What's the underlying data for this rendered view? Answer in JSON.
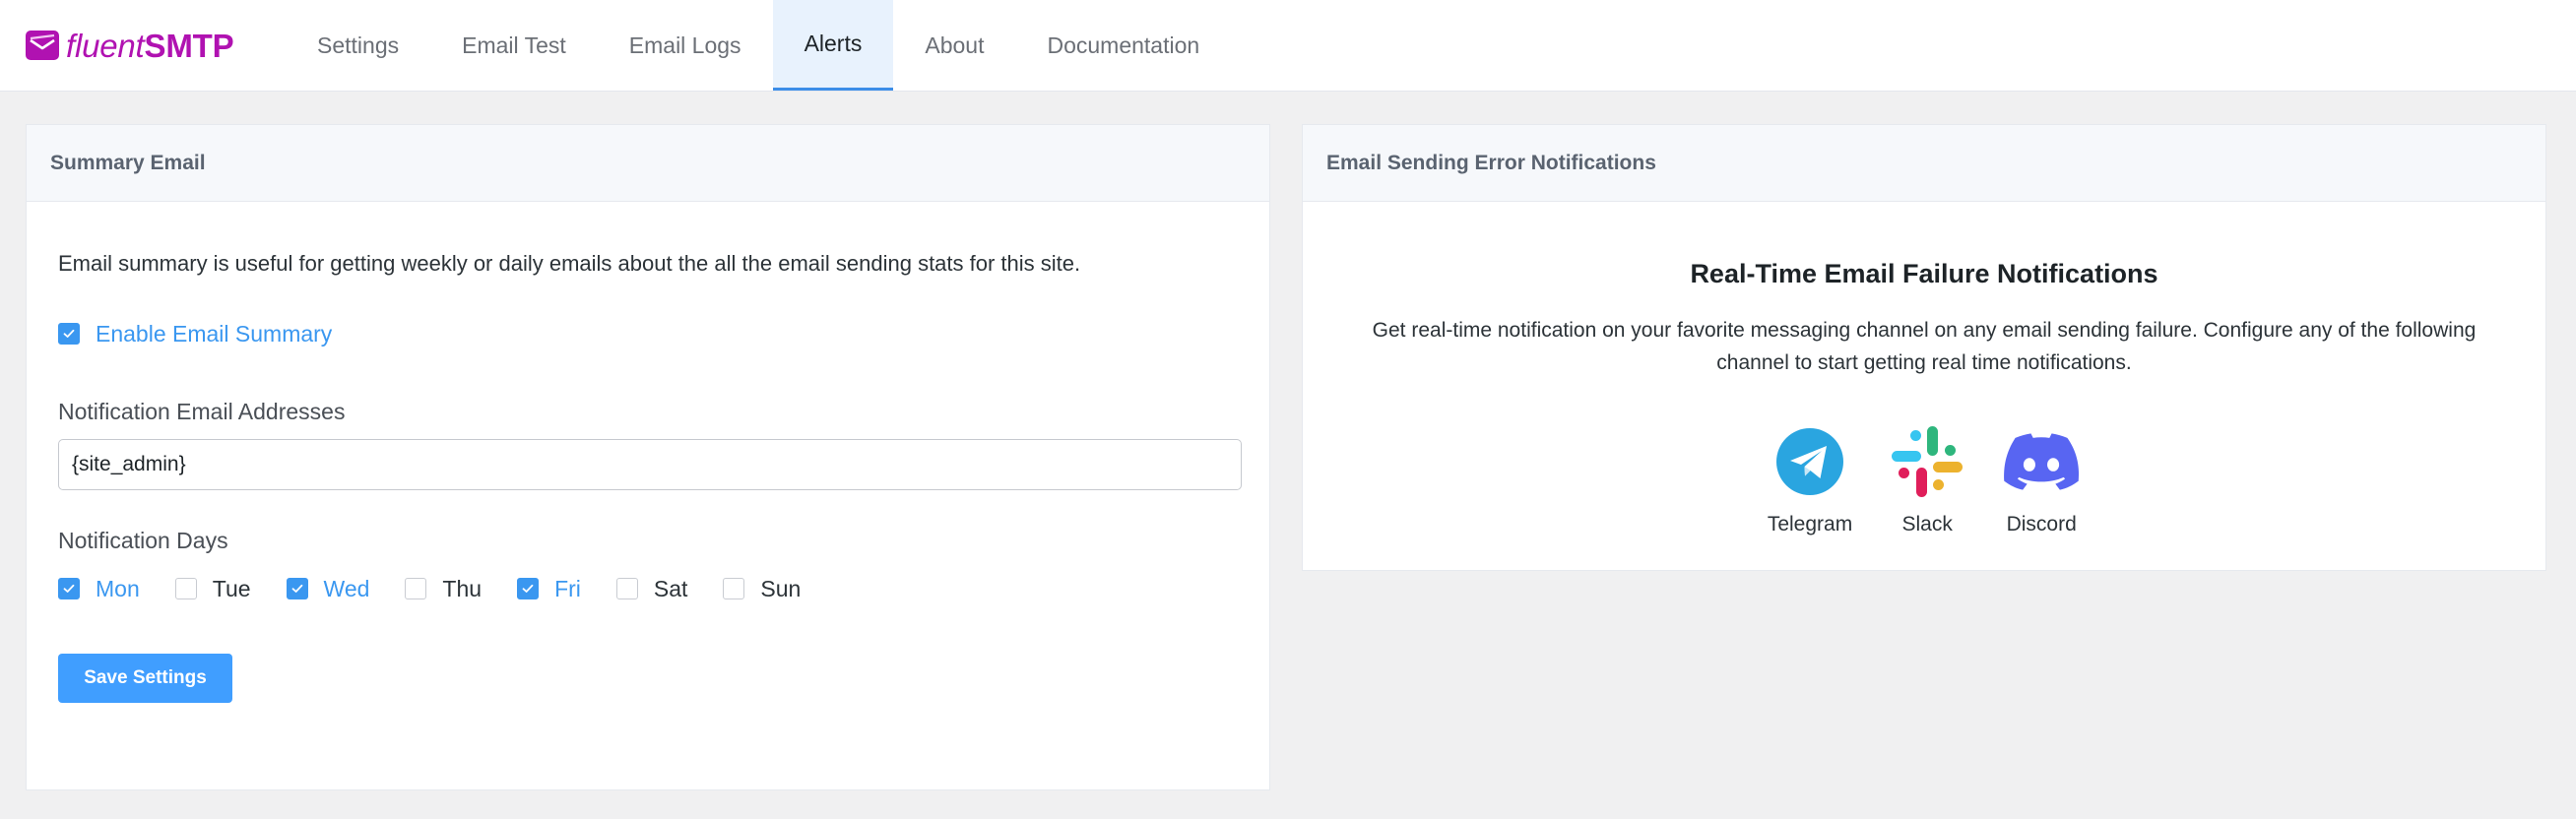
{
  "brand": {
    "light": "fluent",
    "bold": "SMTP",
    "color": "#b012b1"
  },
  "nav": {
    "tabs": [
      {
        "label": "Settings",
        "active": false
      },
      {
        "label": "Email Test",
        "active": false
      },
      {
        "label": "Email Logs",
        "active": false
      },
      {
        "label": "Alerts",
        "active": true
      },
      {
        "label": "About",
        "active": false
      },
      {
        "label": "Documentation",
        "active": false
      }
    ]
  },
  "summary": {
    "title": "Summary Email",
    "description": "Email summary is useful for getting weekly or daily emails about the all the email sending stats for this site.",
    "enable_label": "Enable Email Summary",
    "enable_checked": true,
    "addresses_label": "Notification Email Addresses",
    "addresses_value": "{site_admin}",
    "days_label": "Notification Days",
    "days": [
      {
        "label": "Mon",
        "checked": true
      },
      {
        "label": "Tue",
        "checked": false
      },
      {
        "label": "Wed",
        "checked": true
      },
      {
        "label": "Thu",
        "checked": false
      },
      {
        "label": "Fri",
        "checked": true
      },
      {
        "label": "Sat",
        "checked": false
      },
      {
        "label": "Sun",
        "checked": false
      }
    ],
    "save_label": "Save Settings"
  },
  "notifications": {
    "title": "Email Sending Error Notifications",
    "heading": "Real-Time Email Failure Notifications",
    "description": "Get real-time notification on your favorite messaging channel on any email sending failure. Configure any of the following channel to start getting real time notifications.",
    "channels": [
      {
        "label": "Telegram",
        "icon": "telegram-icon"
      },
      {
        "label": "Slack",
        "icon": "slack-icon"
      },
      {
        "label": "Discord",
        "icon": "discord-icon"
      }
    ]
  },
  "colors": {
    "accent": "#409eff",
    "checked": "#3a97f0",
    "active_tab_bg": "#e8f2fd",
    "telegram": "#2aa5e0",
    "discord": "#5865f2"
  }
}
